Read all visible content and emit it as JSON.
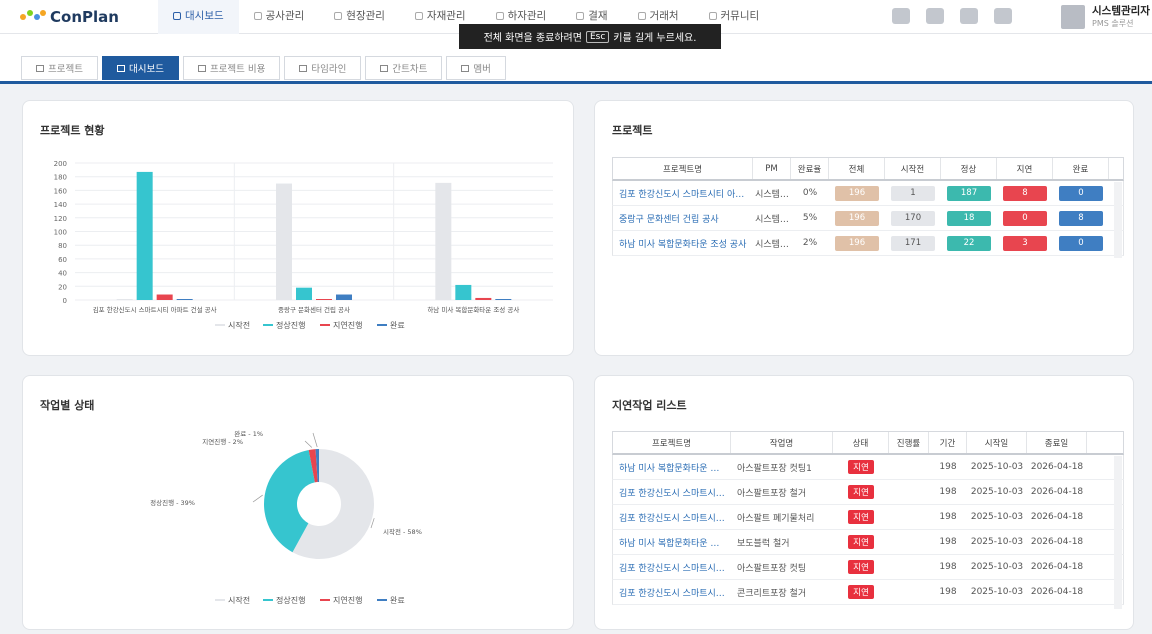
{
  "app": {
    "name": "ConPlan"
  },
  "nav": [
    {
      "label": "대시보드",
      "active": true
    },
    {
      "label": "공사관리"
    },
    {
      "label": "현장관리"
    },
    {
      "label": "자재관리"
    },
    {
      "label": "하자관리"
    },
    {
      "label": "결재"
    },
    {
      "label": "거래처"
    },
    {
      "label": "커뮤니티"
    }
  ],
  "toast": {
    "prefix": "전체 화면을 종료하려면",
    "key": "Esc",
    "suffix": "키를 길게 누르세요."
  },
  "header_icons": [
    "monitor-icon",
    "send-icon",
    "users-icon",
    "card-icon"
  ],
  "user": {
    "name": "시스템관리자",
    "role": "PMS 솔루션"
  },
  "tabs": [
    {
      "label": "프로젝트"
    },
    {
      "label": "대시보드",
      "active": true
    },
    {
      "label": "프로젝트 비용"
    },
    {
      "label": "타임라인"
    },
    {
      "label": "간트차트"
    },
    {
      "label": "멤버"
    }
  ],
  "overview": {
    "title": "프로젝트 현황",
    "chart_data": {
      "type": "bar",
      "categories": [
        "김포 한강신도시 스마트시티 아파트 건설 공사",
        "중랑구 문화센터 건립 공사",
        "하남 미사 복합문화타운 조성 공사"
      ],
      "series": [
        {
          "name": "시작전",
          "color": "#e4e6ea",
          "values": [
            1,
            170,
            171
          ]
        },
        {
          "name": "정상진행",
          "color": "#36c5cf",
          "values": [
            187,
            18,
            22
          ]
        },
        {
          "name": "지연진행",
          "color": "#e8454f",
          "values": [
            8,
            0,
            3
          ]
        },
        {
          "name": "완료",
          "color": "#3f7ec2",
          "values": [
            0,
            8,
            0
          ]
        }
      ],
      "ylim": [
        0,
        200
      ],
      "yticks": [
        0,
        20,
        40,
        60,
        80,
        100,
        120,
        140,
        160,
        180,
        200
      ],
      "legend": "bottom"
    }
  },
  "projects": {
    "title": "프로젝트",
    "columns": [
      "프로젝트명",
      "PM",
      "완료율",
      "전체",
      "시작전",
      "정상",
      "지연",
      "완료"
    ],
    "rows": [
      {
        "name": "김포 한강신도시 스마트시티 아…",
        "pm": "시스템…",
        "rate": "0%",
        "total": "196",
        "before": "1",
        "normal": "187",
        "delay": "8",
        "done": "0"
      },
      {
        "name": "중랑구 문화센터 건립 공사",
        "pm": "시스템…",
        "rate": "5%",
        "total": "196",
        "before": "170",
        "normal": "18",
        "delay": "0",
        "done": "8"
      },
      {
        "name": "하남 미사 복합문화타운 조성 공사",
        "pm": "시스템…",
        "rate": "2%",
        "total": "196",
        "before": "171",
        "normal": "22",
        "delay": "3",
        "done": "0"
      }
    ]
  },
  "task_status": {
    "title": "작업별 상태",
    "chart_data": {
      "type": "pie",
      "labels": [
        "시작전",
        "정상진행",
        "지연진행",
        "완료"
      ],
      "values": [
        58,
        39,
        2,
        1
      ],
      "colors": [
        "#e4e6ea",
        "#36c5cf",
        "#e8454f",
        "#3f7ec2"
      ],
      "slice_labels": [
        "시작전 - 58%",
        "정상진행 - 39%",
        "지연진행 - 2%",
        "완료 - 1%"
      ],
      "legend": "bottom"
    }
  },
  "delayed": {
    "title": "지연작업 리스트",
    "columns": [
      "프로젝트명",
      "작업명",
      "상태",
      "진행률",
      "기간",
      "시작일",
      "종료일"
    ],
    "rows": [
      {
        "project": "하남 미사 복합문화타운 …",
        "task": "아스팔트포장 컷팅1",
        "status": "지연",
        "progress": "",
        "days": "198",
        "start": "2025-10-03",
        "end": "2026-04-18"
      },
      {
        "project": "김포 한강신도시 스마트시…",
        "task": "아스팔트포장 철거",
        "status": "지연",
        "progress": "",
        "days": "198",
        "start": "2025-10-03",
        "end": "2026-04-18"
      },
      {
        "project": "김포 한강신도시 스마트시…",
        "task": "아스팔트 폐기물처리",
        "status": "지연",
        "progress": "",
        "days": "198",
        "start": "2025-10-03",
        "end": "2026-04-18"
      },
      {
        "project": "하남 미사 복합문화타운 …",
        "task": "보도블럭 철거",
        "status": "지연",
        "progress": "",
        "days": "198",
        "start": "2025-10-03",
        "end": "2026-04-18"
      },
      {
        "project": "김포 한강신도시 스마트시…",
        "task": "아스팔트포장 컷팅",
        "status": "지연",
        "progress": "",
        "days": "198",
        "start": "2025-10-03",
        "end": "2026-04-18"
      },
      {
        "project": "김포 한강신도시 스마트시…",
        "task": "콘크리트포장 철거",
        "status": "지연",
        "progress": "",
        "days": "198",
        "start": "2025-10-03",
        "end": "2026-04-18"
      }
    ]
  },
  "colors": {
    "primary": "#1f5a9e",
    "before": "#e0c1a8",
    "before_count": "#e4e6ea",
    "normal": "#3cb9ae",
    "delay": "#e8454f",
    "done": "#3f7ec2"
  }
}
